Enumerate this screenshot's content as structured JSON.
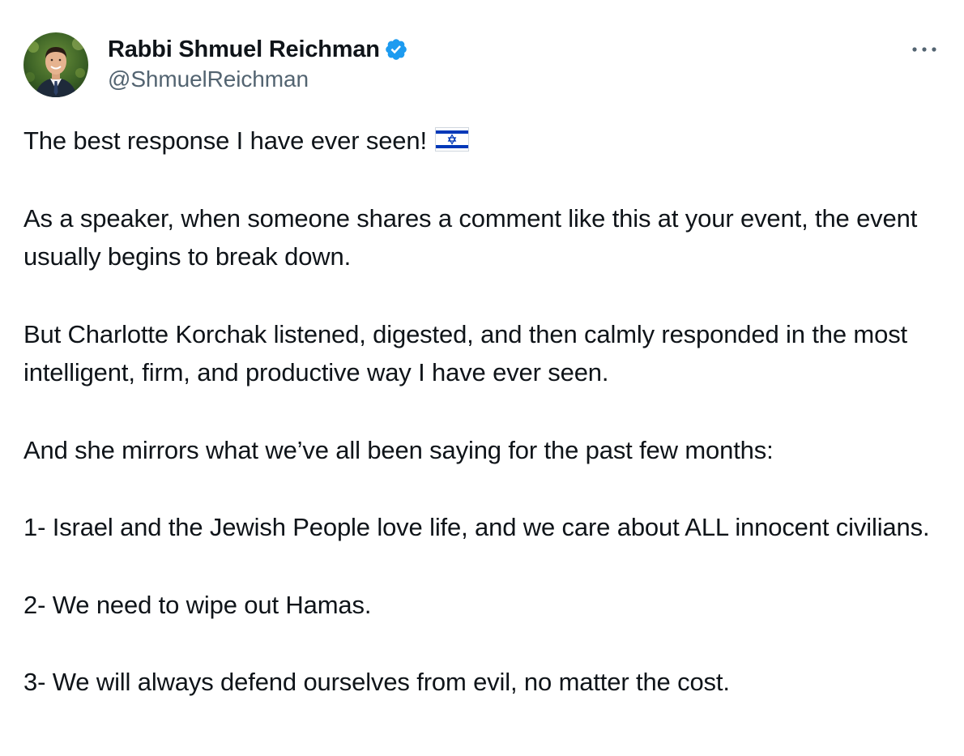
{
  "author": {
    "display_name": "Rabbi Shmuel Reichman",
    "handle": "@ShmuelReichman",
    "verified": true,
    "avatar": "profile-photo"
  },
  "actions": {
    "more_icon": "more-options-ellipsis-icon"
  },
  "tweet": {
    "paragraphs": [
      {
        "text": "The best response I have ever seen!",
        "emoji": "flag-israel-icon"
      },
      {
        "text": "As a speaker, when someone shares a comment like this at your event, the event usually begins to break down."
      },
      {
        "text": "But Charlotte Korchak listened, digested, and then calmly responded in the most intelligent, firm, and productive way I have ever seen."
      },
      {
        "text": "And she mirrors what we’ve all been saying for the past few months:"
      },
      {
        "text": "1- Israel and the Jewish People love life, and we care about ALL innocent civilians."
      },
      {
        "text": "2- We need to wipe out Hamas."
      },
      {
        "text": "3- We will always defend ourselves from evil, no matter the cost."
      }
    ]
  },
  "colors": {
    "text_primary": "#0f1419",
    "text_secondary": "#536471",
    "verified_blue": "#1d9bf0",
    "flag_blue": "#0038b8"
  }
}
